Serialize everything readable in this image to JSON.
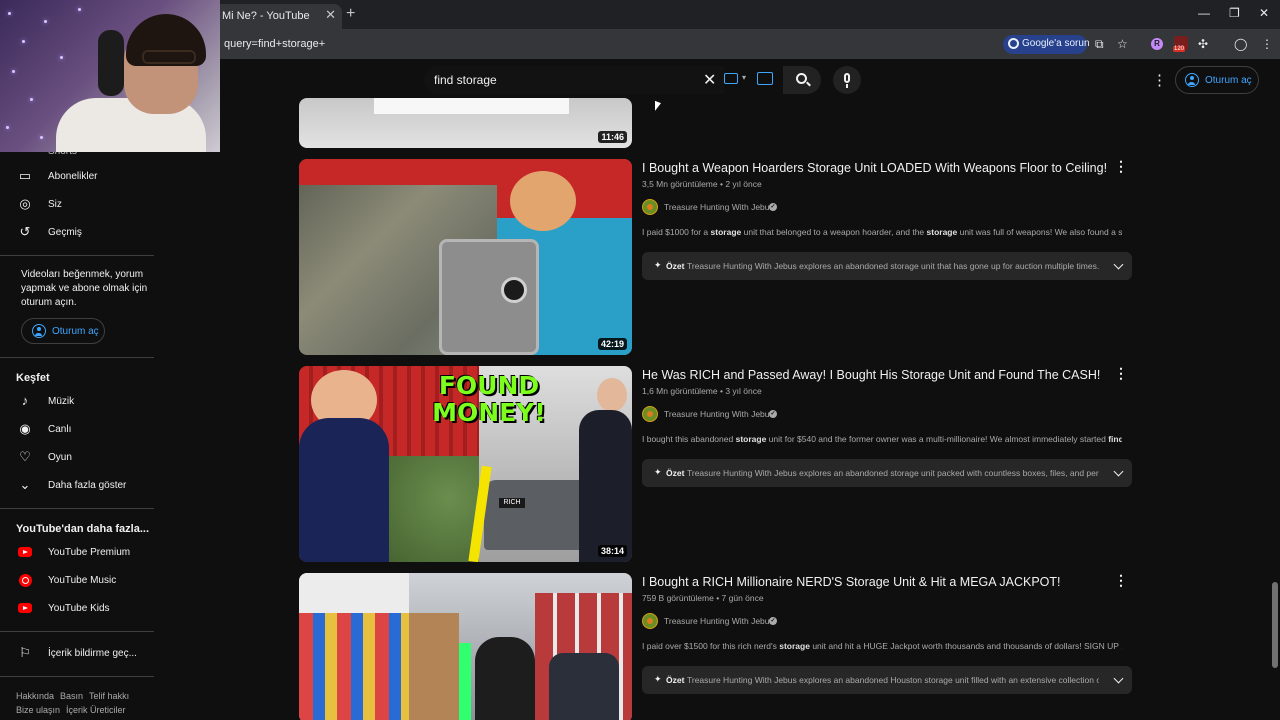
{
  "browser": {
    "tab_title": "Mi Ne? - YouTube",
    "url": "query=find+storage+",
    "google_pill": "Google'a sorun",
    "extension_badge": "120"
  },
  "header": {
    "search_value": "find storage",
    "signin_label": "Oturum aç"
  },
  "sidebar": {
    "partial_label": "Shorts",
    "items": [
      {
        "label": "Abonelikler",
        "icon": "subscriptions-icon"
      },
      {
        "label": "Siz",
        "icon": "account-icon"
      },
      {
        "label": "Geçmiş",
        "icon": "history-icon"
      }
    ],
    "signin_prompt_lines": [
      "Videoları beğenmek, yorum",
      "yapmak ve abone olmak için",
      "oturum açın."
    ],
    "signin_label": "Oturum aç",
    "explore_heading": "Keşfet",
    "explore_items": [
      {
        "label": "Müzik",
        "icon": "music-note-icon"
      },
      {
        "label": "Canlı",
        "icon": "live-icon"
      },
      {
        "label": "Oyun",
        "icon": "gaming-icon"
      },
      {
        "label": "Daha fazla göster",
        "icon": "chevron-down-icon"
      }
    ],
    "more_heading": "YouTube'dan daha fazla...",
    "more_items": [
      {
        "label": "YouTube Premium",
        "icon": "youtube-premium-icon"
      },
      {
        "label": "YouTube Music",
        "icon": "youtube-music-icon"
      },
      {
        "label": "YouTube Kids",
        "icon": "youtube-kids-icon"
      }
    ],
    "report_label": "İçerik bildirme geç...",
    "footer_line1": [
      "Hakkında",
      "Basın",
      "Telif hakkı"
    ],
    "footer_line2": [
      "Bize ulaşın",
      "İçerik Üreticiler"
    ]
  },
  "results": {
    "partial_duration": "11:46",
    "summary_label": "Özet",
    "videos": [
      {
        "title": "I Bought a Weapon Hoarders Storage Unit LOADED With Weapons Floor to Ceiling!",
        "views": "3,5 Mn görüntüleme",
        "age": "2 yıl önce",
        "channel": "Treasure Hunting With Jebus",
        "desc_parts": [
          "I paid $1000 for a ",
          "storage",
          " unit that belonged to a weapon hoarder, and the ",
          "storage",
          " unit was full of weapons! We also found a safe, ..."
        ],
        "summary": "Treasure Hunting With Jebus explores an abandoned storage unit that has gone up for auction multiple times. The...",
        "duration": "42:19"
      },
      {
        "title": "He Was RICH and Passed Away! I Bought His Storage Unit and Found The CASH!",
        "views": "1,6 Mn görüntüleme",
        "age": "3 yıl önce",
        "channel": "Treasure Hunting With Jebus",
        "desc_parts": [
          "I bought this abandoned ",
          "storage",
          " unit for $540 and the former owner was a multi-millionaire! We almost immediately started ",
          "finding",
          " ..."
        ],
        "summary": "Treasure Hunting With Jebus explores an abandoned storage unit packed with countless boxes, files, and personal...",
        "duration": "38:14",
        "thumb_text": "FOUND MONEY!",
        "thumb_plate": "RICH"
      },
      {
        "title": "I Bought a RICH Millionaire NERD'S Storage Unit & Hit a MEGA JACKPOT!",
        "views": "759 B görüntüleme",
        "age": "7 gün önce",
        "channel": "Treasure Hunting With Jebus",
        "desc_parts": [
          "I paid over $1500 for this rich nerd's ",
          "storage",
          " unit and hit a HUGE Jackpot worth thousands and thousands of dollars! SIGN UP ...",
          "",
          ""
        ],
        "summary": "Treasure Hunting With Jebus explores an abandoned Houston storage unit filled with an extensive collection of...",
        "duration": ""
      }
    ]
  }
}
